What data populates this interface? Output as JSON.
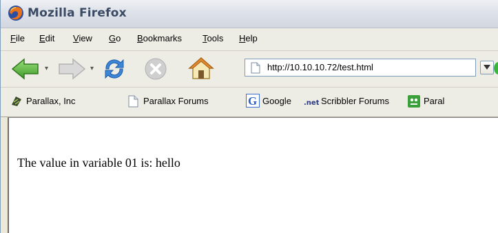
{
  "window": {
    "title": "Mozilla Firefox"
  },
  "menu": [
    {
      "label": "File",
      "acc": "F",
      "rest": "ile"
    },
    {
      "label": "Edit",
      "acc": "E",
      "rest": "dit"
    },
    {
      "label": "View",
      "acc": "V",
      "rest": "iew"
    },
    {
      "label": "Go",
      "acc": "G",
      "rest": "o"
    },
    {
      "label": "Bookmarks",
      "acc": "B",
      "rest": "ookmarks"
    },
    {
      "label": "Tools",
      "acc": "T",
      "rest": "ools"
    },
    {
      "label": "Help",
      "acc": "H",
      "rest": "elp"
    }
  ],
  "navigation": {
    "url": "http://10.10.10.72/test.html"
  },
  "bookmarks": [
    {
      "label": "Parallax, Inc",
      "icon": "parallax-icon"
    },
    {
      "label": "Parallax Forums",
      "icon": "page-icon"
    },
    {
      "label": "Google",
      "icon": "google-icon"
    },
    {
      "label": "Scribbler Forums",
      "icon": "dotnet-icon"
    },
    {
      "label": "Paral",
      "icon": "scribbler-icon"
    }
  ],
  "page": {
    "text": "The value in variable 01 is: hello"
  }
}
